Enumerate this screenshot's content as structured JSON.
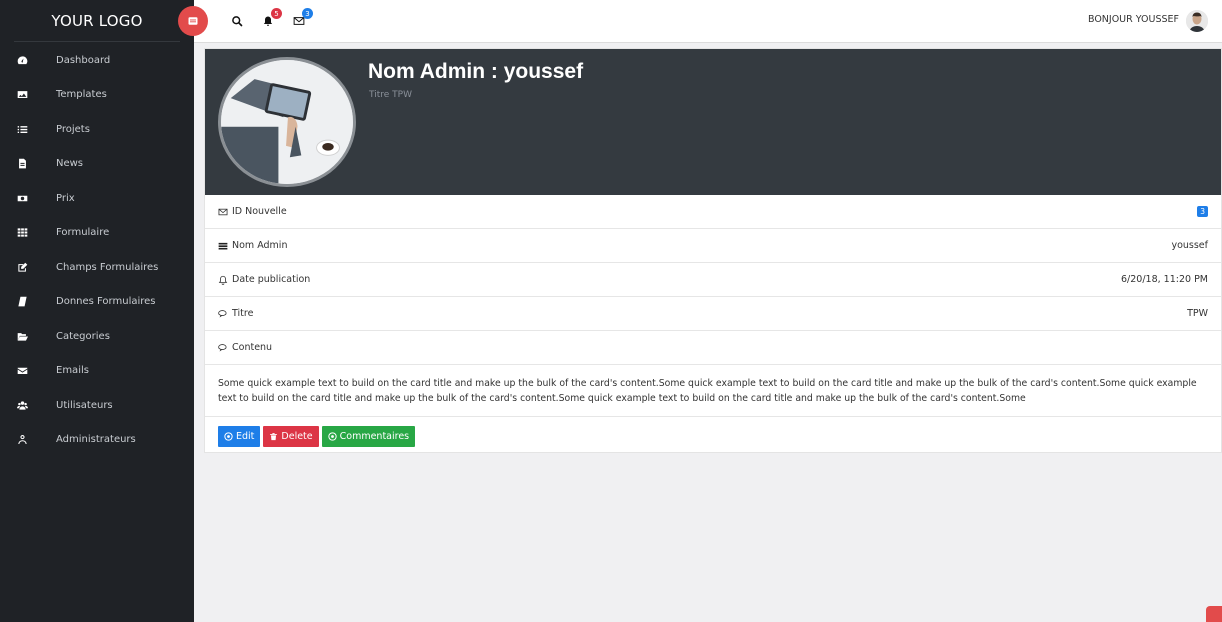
{
  "sidebar": {
    "logo": "YOUR LOGO",
    "items": [
      {
        "label": "Dashboard",
        "icon": "dashboard-icon"
      },
      {
        "label": "Templates",
        "icon": "image-icon"
      },
      {
        "label": "Projets",
        "icon": "list-icon"
      },
      {
        "label": "News",
        "icon": "file-icon"
      },
      {
        "label": "Prix",
        "icon": "money-icon"
      },
      {
        "label": "Formulaire",
        "icon": "grid-icon"
      },
      {
        "label": "Champs Formulaires",
        "icon": "edit-icon"
      },
      {
        "label": "Donnes Formulaires",
        "icon": "book-icon"
      },
      {
        "label": "Categories",
        "icon": "folder-icon"
      },
      {
        "label": "Emails",
        "icon": "envelope-icon"
      },
      {
        "label": "Utilisateurs",
        "icon": "users-icon"
      },
      {
        "label": "Administrateurs",
        "icon": "user-icon"
      }
    ]
  },
  "topbar": {
    "notifications_count": "5",
    "messages_count": "3",
    "greeting": "BONJOUR YOUSSEF"
  },
  "card": {
    "title": "Nom Admin : youssef",
    "subtitle": "Titre TPW",
    "rows": [
      {
        "label": "ID Nouvelle",
        "value": "3",
        "icon": "envelope-icon"
      },
      {
        "label": "Nom Admin",
        "value": "youssef",
        "icon": "bars-icon"
      },
      {
        "label": "Date publication",
        "value": "6/20/18, 11:20 PM",
        "icon": "bell-icon"
      },
      {
        "label": "Titre",
        "value": "TPW",
        "icon": "comments-icon"
      },
      {
        "label": "Contenu",
        "value": "",
        "icon": "comments-icon"
      }
    ],
    "content": "Some quick example text to build on the card title and make up the bulk of the card's content.Some quick example text to build on the card title and make up the bulk of the card's content.Some quick example text to build on the card title and make up the bulk of the card's content.Some quick example text to build on the card title and make up the bulk of the card's content.Some",
    "buttons": {
      "edit": "Edit",
      "delete": "Delete",
      "comments": "Commentaires"
    }
  },
  "colors": {
    "sidebar_bg": "#1f2226",
    "card_header_bg": "#343a40",
    "primary": "#1e7ee8",
    "danger": "#dc3545",
    "success": "#28a745",
    "toggle": "#e24b4b"
  }
}
